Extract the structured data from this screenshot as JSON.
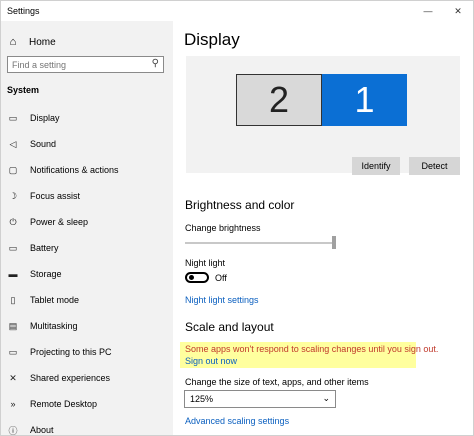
{
  "window": {
    "title": "Settings",
    "controls": {
      "minimize": "—",
      "close": "✕"
    }
  },
  "sidebar": {
    "home_label": "Home",
    "search_placeholder": "Find a setting",
    "section": "System",
    "items": [
      {
        "label": "Display",
        "icon": "monitor-icon",
        "glyph": "▭"
      },
      {
        "label": "Sound",
        "icon": "speaker-icon",
        "glyph": "◁"
      },
      {
        "label": "Notifications & actions",
        "icon": "notification-icon",
        "glyph": "▢"
      },
      {
        "label": "Focus assist",
        "icon": "moon-icon",
        "glyph": "☽"
      },
      {
        "label": "Power & sleep",
        "icon": "power-icon",
        "glyph": "⏻"
      },
      {
        "label": "Battery",
        "icon": "battery-icon",
        "glyph": "▭"
      },
      {
        "label": "Storage",
        "icon": "storage-icon",
        "glyph": "▬"
      },
      {
        "label": "Tablet mode",
        "icon": "tablet-icon",
        "glyph": "▯"
      },
      {
        "label": "Multitasking",
        "icon": "multitasking-icon",
        "glyph": "▤"
      },
      {
        "label": "Projecting to this PC",
        "icon": "projecting-icon",
        "glyph": "▭"
      },
      {
        "label": "Shared experiences",
        "icon": "shared-icon",
        "glyph": "✕"
      },
      {
        "label": "Remote Desktop",
        "icon": "remote-desktop-icon",
        "glyph": "»"
      },
      {
        "label": "About",
        "icon": "info-icon",
        "glyph": "ⓘ"
      }
    ]
  },
  "main": {
    "title": "Display",
    "monitors": {
      "left": "2",
      "right": "1"
    },
    "identify_label": "Identify",
    "detect_label": "Detect",
    "brightness": {
      "heading": "Brightness and color",
      "change_label": "Change brightness",
      "level": 1.0
    },
    "night_light": {
      "label": "Night light",
      "state": "Off",
      "settings_link": "Night light settings"
    },
    "scale": {
      "heading": "Scale and layout",
      "warning": "Some apps won't respond to scaling changes until you sign out.",
      "sign_out": "Sign out now",
      "size_label": "Change the size of text, apps, and other items",
      "size_value": "125%",
      "advanced_link": "Advanced scaling settings"
    }
  },
  "colors": {
    "accent": "#0b6fd4",
    "sidebar_bg": "#f2f2f2",
    "warning_bg": "#ffff9e",
    "warning_text": "#c0392b",
    "link": "#0a5fbf"
  }
}
